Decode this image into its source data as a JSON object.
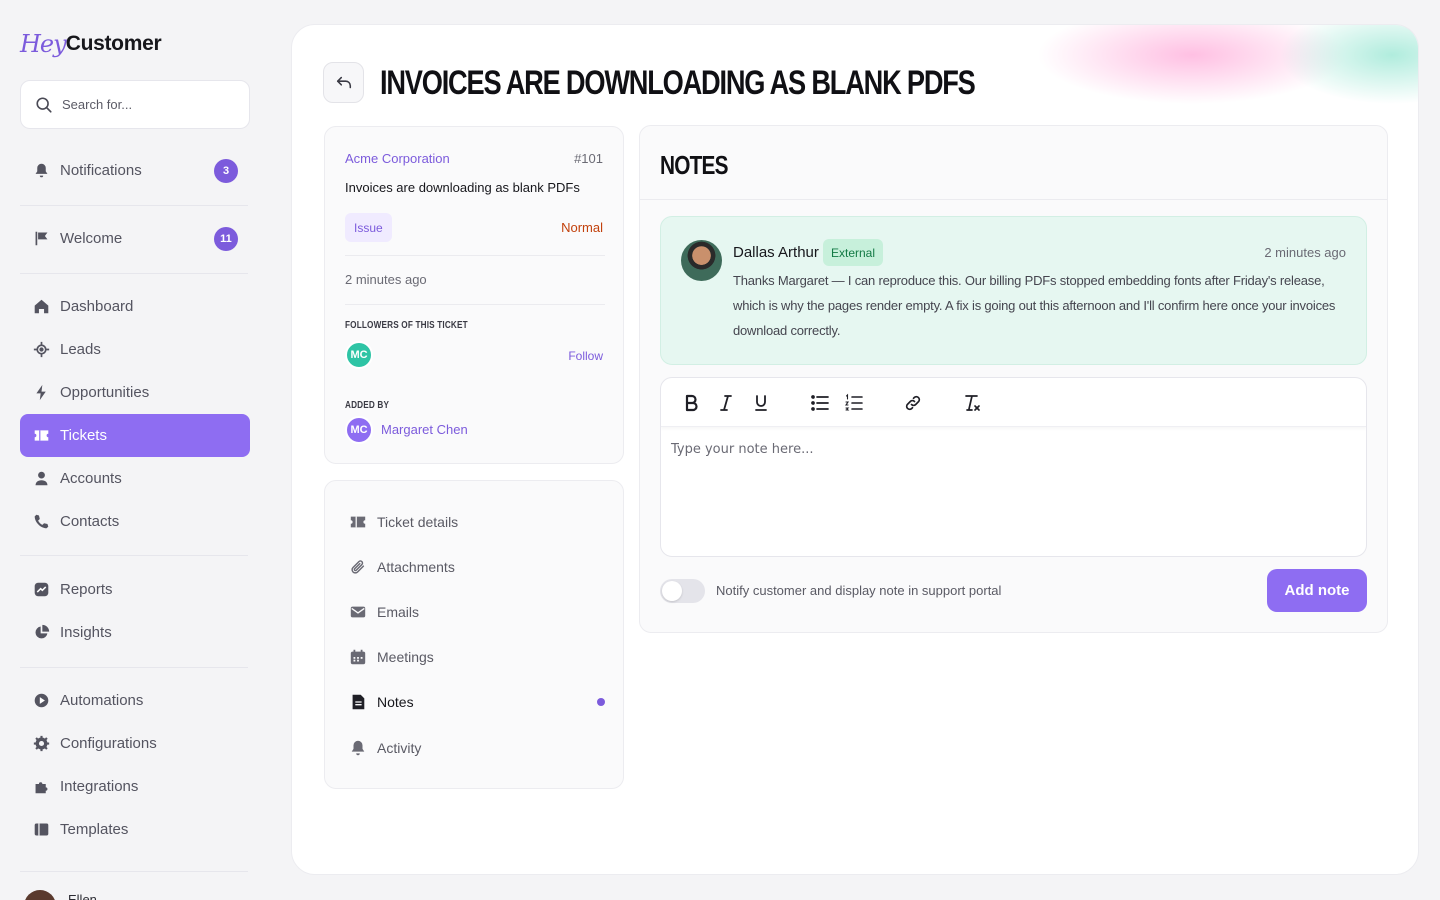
{
  "app": {
    "logo_hey": "Hey",
    "logo_customer": "Customer"
  },
  "search": {
    "placeholder": "Search for..."
  },
  "sidebar": {
    "items": [
      {
        "label": "Notifications",
        "badge": "3"
      },
      {
        "label": "Welcome",
        "badge": "11"
      },
      {
        "label": "Dashboard"
      },
      {
        "label": "Leads"
      },
      {
        "label": "Opportunities"
      },
      {
        "label": "Tickets"
      },
      {
        "label": "Accounts"
      },
      {
        "label": "Contacts"
      },
      {
        "label": "Reports"
      },
      {
        "label": "Insights"
      },
      {
        "label": "Automations"
      },
      {
        "label": "Configurations"
      },
      {
        "label": "Integrations"
      },
      {
        "label": "Templates"
      }
    ],
    "active_item": "Tickets",
    "user_name": "Ellen"
  },
  "page": {
    "title": "Invoices are downloading as blank PDFs"
  },
  "ticket": {
    "company": "Acme Corporation",
    "number": "#101",
    "subject": "Invoices are downloading as blank PDFs",
    "type": "Issue",
    "priority": "Normal",
    "created": "2 minutes ago",
    "followers_caption": "Followers of this ticket",
    "follower_initials": "MC",
    "follow_label": "Follow",
    "added_by_caption": "Added by",
    "added_by_initials": "MC",
    "added_by_name": "Margaret Chen"
  },
  "sections": {
    "items": [
      {
        "label": "Ticket details"
      },
      {
        "label": "Attachments"
      },
      {
        "label": "Emails"
      },
      {
        "label": "Meetings"
      },
      {
        "label": "Notes"
      },
      {
        "label": "Activity"
      }
    ],
    "active_item": "Notes"
  },
  "notes": {
    "title": "Notes",
    "list": [
      {
        "author": "Dallas Arthur",
        "tag": "External",
        "time": "2 minutes ago",
        "body": "Thanks Margaret — I can reproduce this. Our billing PDFs stopped embedding fonts after Friday's release, which is why the pages render empty. A fix is going out this afternoon and I'll confirm here once your invoices download correctly."
      }
    ],
    "editor": {
      "placeholder": "Type your note here...",
      "value": "",
      "toolbar": [
        "bold",
        "italic",
        "underline",
        "bullet-list",
        "numbered-list",
        "link",
        "clear-format"
      ]
    },
    "notify_toggle": {
      "label": "Notify customer and display note in support portal",
      "on": false
    },
    "add_button": "Add note"
  },
  "colors": {
    "accent": "#8e6df2",
    "accent_dark": "#7c5bdc",
    "priority_normal": "#c2410c",
    "external_tag_bg": "#c7f0db",
    "note_bg": "#e6f7f1",
    "follower_avatar": "#2ec4a5"
  }
}
